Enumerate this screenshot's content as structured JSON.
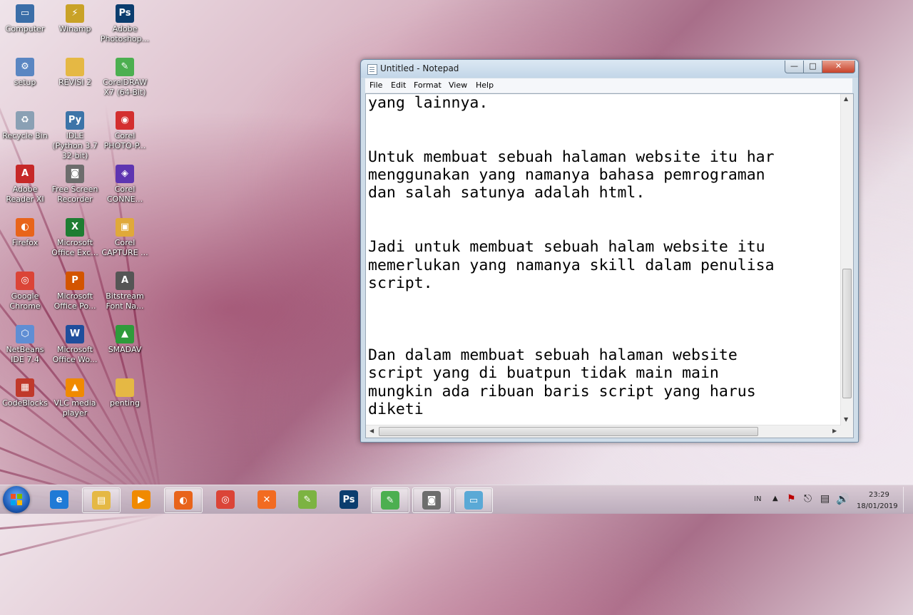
{
  "desktop": {
    "icons": [
      {
        "label": "Computer",
        "glyph": "computer-icon",
        "color": "#3b6ea8",
        "symbol": "▭"
      },
      {
        "label": "Winamp",
        "glyph": "winamp-icon",
        "color": "#c9a227",
        "symbol": "⚡"
      },
      {
        "label": "Adobe Photoshop...",
        "glyph": "photoshop-icon",
        "color": "#0b3d6e",
        "symbol": "Ps"
      },
      {
        "label": "setup",
        "glyph": "setup-icon",
        "color": "#5a86c2",
        "symbol": "⚙"
      },
      {
        "label": "REVISI 2",
        "glyph": "folder-icon",
        "color": "#e5b844",
        "symbol": ""
      },
      {
        "label": "CorelDRAW X7 (64-Bit)",
        "glyph": "coreldraw-icon",
        "color": "#4caf50",
        "symbol": "✎"
      },
      {
        "label": "Recycle Bin",
        "glyph": "recycle-bin-icon",
        "color": "#8aa0b4",
        "symbol": "♻"
      },
      {
        "label": "IDLE (Python 3.7 32-bit)",
        "glyph": "python-icon",
        "color": "#3c74a8",
        "symbol": "Py"
      },
      {
        "label": "Corel PHOTO-P...",
        "glyph": "corel-photopaint-icon",
        "color": "#d32f2f",
        "symbol": "◉"
      },
      {
        "label": "Adobe Reader XI",
        "glyph": "acrobat-icon",
        "color": "#c62828",
        "symbol": "A"
      },
      {
        "label": "Free Screen Recorder",
        "glyph": "camera-icon",
        "color": "#6d6d6d",
        "symbol": "◙"
      },
      {
        "label": "Corel CONNE...",
        "glyph": "corel-connect-icon",
        "color": "#5e35b1",
        "symbol": "◈"
      },
      {
        "label": "Firefox",
        "glyph": "firefox-icon",
        "color": "#e8641b",
        "symbol": "◐"
      },
      {
        "label": "Microsoft Office Exc...",
        "glyph": "excel-icon",
        "color": "#1e7d32",
        "symbol": "X"
      },
      {
        "label": "Corel CAPTURE ...",
        "glyph": "corel-capture-icon",
        "color": "#e0a93a",
        "symbol": "▣"
      },
      {
        "label": "Google Chrome",
        "glyph": "chrome-icon",
        "color": "#db4437",
        "symbol": "◎"
      },
      {
        "label": "Microsoft Office Po...",
        "glyph": "powerpoint-icon",
        "color": "#d35400",
        "symbol": "P"
      },
      {
        "label": "Bitstream Font Na...",
        "glyph": "font-icon",
        "color": "#555555",
        "symbol": "A"
      },
      {
        "label": "NetBeans IDE 7.4",
        "glyph": "netbeans-icon",
        "color": "#5f8ed4",
        "symbol": "⬡"
      },
      {
        "label": "Microsoft Office Wo...",
        "glyph": "word-icon",
        "color": "#1f4e9c",
        "symbol": "W"
      },
      {
        "label": "SMADAV",
        "glyph": "smadav-icon",
        "color": "#2e9b3b",
        "symbol": "▲"
      },
      {
        "label": "CodeBlocks",
        "glyph": "codeblocks-icon",
        "color": "#c0392b",
        "symbol": "▦"
      },
      {
        "label": "VLC media player",
        "glyph": "vlc-icon",
        "color": "#f08a00",
        "symbol": "▲"
      },
      {
        "label": "penting",
        "glyph": "folder-icon",
        "color": "#e5b844",
        "symbol": ""
      }
    ]
  },
  "notepad": {
    "title": "Untitled - Notepad",
    "menu": [
      "File",
      "Edit",
      "Format",
      "View",
      "Help"
    ],
    "content": "yang lainnya.\n\n\nUntuk membuat sebuah halaman website itu har\nmenggunakan yang namanya bahasa pemrograman\ndan salah satunya adalah html.\n\n\nJadi untuk membuat sebuah halam website itu\nmemerlukan yang namanya skill dalam penulisa\nscript.\n\n\n\nDan dalam membuat sebuah halaman website\nscript yang di buatpun tidak main main\nmungkin ada ribuan baris script yang harus\ndiketi"
  },
  "taskbar": {
    "buttons": [
      {
        "name": "ie-icon",
        "color": "#1f7ad6",
        "symbol": "e",
        "active": false
      },
      {
        "name": "explorer-icon",
        "color": "#e5b844",
        "symbol": "▤",
        "active": true
      },
      {
        "name": "media-player-icon",
        "color": "#f08a00",
        "symbol": "▶",
        "active": false
      },
      {
        "name": "firefox-icon",
        "color": "#e8641b",
        "symbol": "◐",
        "active": true
      },
      {
        "name": "chrome-icon",
        "color": "#db4437",
        "symbol": "◎",
        "active": false
      },
      {
        "name": "xampp-icon",
        "color": "#f26b21",
        "symbol": "✕",
        "active": false
      },
      {
        "name": "notepad-plus-icon",
        "color": "#7cb342",
        "symbol": "✎",
        "active": false
      },
      {
        "name": "photoshop-icon",
        "color": "#0b3d6e",
        "symbol": "Ps",
        "active": false
      },
      {
        "name": "coreldraw-icon",
        "color": "#4caf50",
        "symbol": "✎",
        "active": true
      },
      {
        "name": "camera-icon",
        "color": "#6d6d6d",
        "symbol": "◙",
        "active": true
      },
      {
        "name": "notepad-icon",
        "color": "#5aa9d6",
        "symbol": "▭",
        "active": true
      }
    ],
    "tray": {
      "language": "IN",
      "time": "23:29",
      "date": "18/01/2019"
    }
  }
}
